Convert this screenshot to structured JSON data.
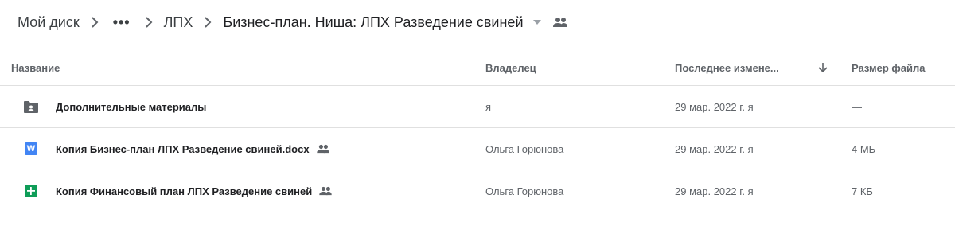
{
  "breadcrumb": {
    "root": "Мой диск",
    "more": "•••",
    "parent": "ЛПХ",
    "current": "Бизнес-план. Ниша: ЛПХ Разведение свиней"
  },
  "columns": {
    "name": "Название",
    "owner": "Владелец",
    "modified": "Последнее измене...",
    "size": "Размер файла"
  },
  "rows": [
    {
      "name": "Дополнительные материалы",
      "type": "shared-folder",
      "shared": false,
      "owner": "я",
      "modified": "29 мар. 2022 г. я",
      "size": "—"
    },
    {
      "name": "Копия Бизнес-план ЛПХ Разведение свиней.docx",
      "type": "word-doc",
      "icon_letter": "W",
      "shared": true,
      "owner": "Ольга Горюнова",
      "modified": "29 мар. 2022 г. я",
      "size": "4 МБ"
    },
    {
      "name": "Копия Финансовый план ЛПХ Разведение свиней",
      "type": "google-sheet",
      "shared": true,
      "owner": "Ольга Горюнова",
      "modified": "29 мар. 2022 г. я",
      "size": "7 КБ"
    }
  ],
  "colors": {
    "folder": "#5f6368",
    "word": "#4285f4",
    "sheets": "#0f9d58"
  }
}
